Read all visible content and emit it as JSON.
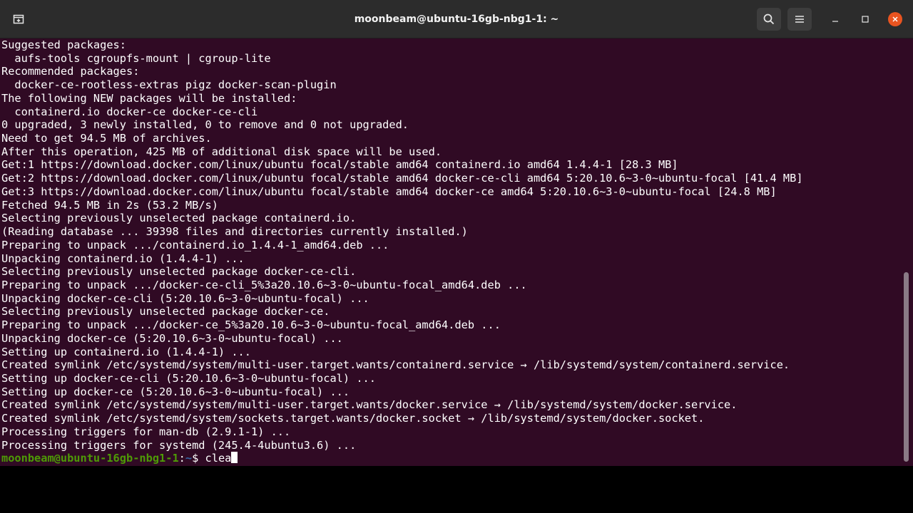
{
  "window": {
    "title": "moonbeam@ubuntu-16gb-nbg1-1: ~"
  },
  "titlebar": {
    "icons": {
      "new_tab": "new-tab-icon",
      "search": "search-icon",
      "menu": "hamburger-menu-icon",
      "minimize": "minimize-icon",
      "maximize": "maximize-icon",
      "close": "close-icon"
    }
  },
  "terminal": {
    "lines": [
      "Suggested packages:",
      "  aufs-tools cgroupfs-mount | cgroup-lite",
      "Recommended packages:",
      "  docker-ce-rootless-extras pigz docker-scan-plugin",
      "The following NEW packages will be installed:",
      "  containerd.io docker-ce docker-ce-cli",
      "0 upgraded, 3 newly installed, 0 to remove and 0 not upgraded.",
      "Need to get 94.5 MB of archives.",
      "After this operation, 425 MB of additional disk space will be used.",
      "Get:1 https://download.docker.com/linux/ubuntu focal/stable amd64 containerd.io amd64 1.4.4-1 [28.3 MB]",
      "Get:2 https://download.docker.com/linux/ubuntu focal/stable amd64 docker-ce-cli amd64 5:20.10.6~3-0~ubuntu-focal [41.4 MB]",
      "Get:3 https://download.docker.com/linux/ubuntu focal/stable amd64 docker-ce amd64 5:20.10.6~3-0~ubuntu-focal [24.8 MB]",
      "Fetched 94.5 MB in 2s (53.2 MB/s)",
      "Selecting previously unselected package containerd.io.",
      "(Reading database ... 39398 files and directories currently installed.)",
      "Preparing to unpack .../containerd.io_1.4.4-1_amd64.deb ...",
      "Unpacking containerd.io (1.4.4-1) ...",
      "Selecting previously unselected package docker-ce-cli.",
      "Preparing to unpack .../docker-ce-cli_5%3a20.10.6~3-0~ubuntu-focal_amd64.deb ...",
      "Unpacking docker-ce-cli (5:20.10.6~3-0~ubuntu-focal) ...",
      "Selecting previously unselected package docker-ce.",
      "Preparing to unpack .../docker-ce_5%3a20.10.6~3-0~ubuntu-focal_amd64.deb ...",
      "Unpacking docker-ce (5:20.10.6~3-0~ubuntu-focal) ...",
      "Setting up containerd.io (1.4.4-1) ...",
      "Created symlink /etc/systemd/system/multi-user.target.wants/containerd.service → /lib/systemd/system/containerd.service.",
      "Setting up docker-ce-cli (5:20.10.6~3-0~ubuntu-focal) ...",
      "Setting up docker-ce (5:20.10.6~3-0~ubuntu-focal) ...",
      "Created symlink /etc/systemd/system/multi-user.target.wants/docker.service → /lib/systemd/system/docker.service.",
      "Created symlink /etc/systemd/system/sockets.target.wants/docker.socket → /lib/systemd/system/docker.socket.",
      "Processing triggers for man-db (2.9.1-1) ...",
      "Processing triggers for systemd (245.4-4ubuntu3.6) ..."
    ],
    "prompt": {
      "user_host": "moonbeam@ubuntu-16gb-nbg1-1",
      "separator": ":",
      "path": "~",
      "symbol": "$ ",
      "command": "clea"
    }
  },
  "colors": {
    "terminal_bg": "#300a24",
    "titlebar_bg": "#2c2c2c",
    "prompt_user": "#4e9a06",
    "prompt_path": "#3465a4",
    "close_button": "#e95420"
  }
}
